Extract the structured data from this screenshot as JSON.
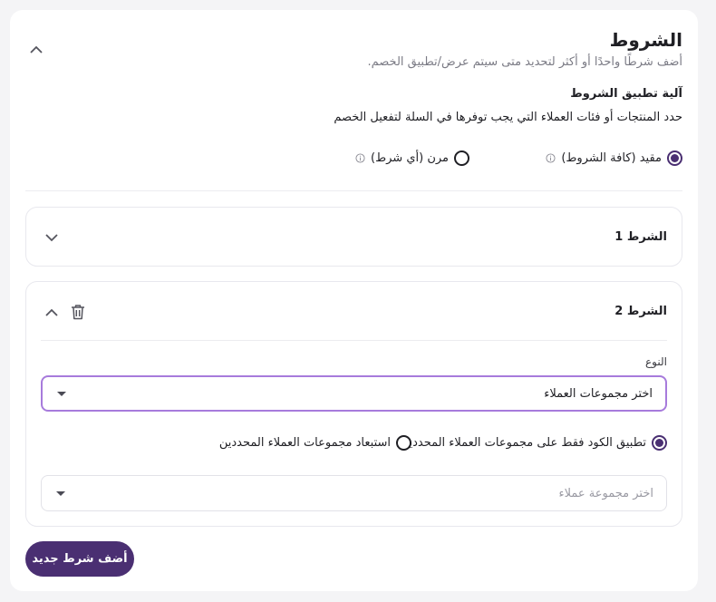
{
  "section": {
    "title": "الشروط",
    "subtitle": "أضف شرطًا واحدًا أو أكثر لتحديد متى سيتم عرض/تطبيق الخصم."
  },
  "mechanism": {
    "label": "آلية تطبيق الشروط",
    "description": "حدد المنتجات أو فئات العملاء التي يجب توفرها في السلة لتفعيل الخصم",
    "options": [
      {
        "label": "مقيد (كافة الشروط)",
        "checked": true
      },
      {
        "label": "مرن (أي شرط)",
        "checked": false
      }
    ]
  },
  "conditions": [
    {
      "title": "الشرط 1",
      "expanded": false
    },
    {
      "title": "الشرط 2",
      "expanded": true,
      "type_label": "النوع",
      "type_value": "اختر مجموعات العملاء",
      "scope_options": [
        {
          "label": "تطبيق الكود فقط على مجموعات العملاء المحددين",
          "checked": true
        },
        {
          "label": "استبعاد مجموعات العملاء المحددين",
          "checked": false
        }
      ],
      "group_placeholder": "اختر مجموعة عملاء"
    }
  ],
  "add_button_label": "أضف شرط جديد",
  "colors": {
    "accent": "#4a2f72",
    "focus_border": "#a77bdc"
  }
}
